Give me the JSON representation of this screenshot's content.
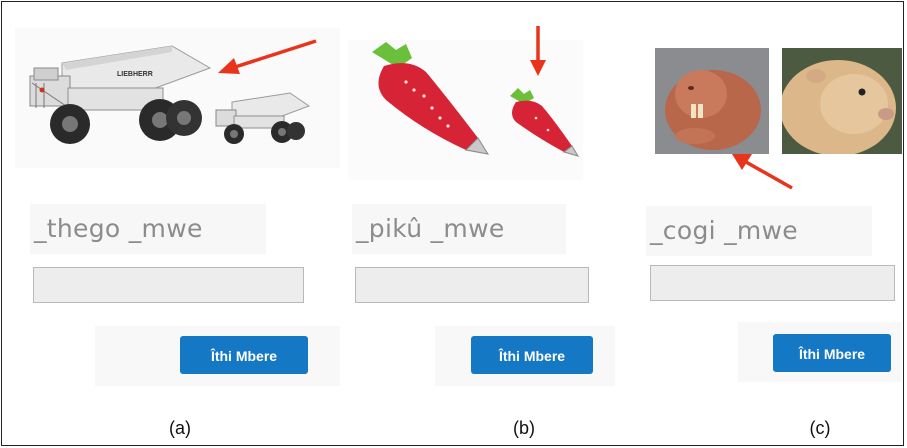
{
  "panels": [
    {
      "id": "a",
      "prompt": "_thego _mwe",
      "answer_value": "",
      "button_label": "Îthi Mbere",
      "caption": "(a)",
      "truck_brand": "LIEBHERR"
    },
    {
      "id": "b",
      "prompt": "_pikû _mwe",
      "answer_value": "",
      "button_label": "Îthi Mbere",
      "caption": "(b)"
    },
    {
      "id": "c",
      "prompt": "_cogi _mwe",
      "answer_value": "",
      "button_label": "Îthi Mbere",
      "caption": "(c)"
    }
  ],
  "colors": {
    "button": "#1478c4",
    "arrow": "#e8341c",
    "prompt_text": "#8c8c8c",
    "input_bg": "#ededed"
  }
}
